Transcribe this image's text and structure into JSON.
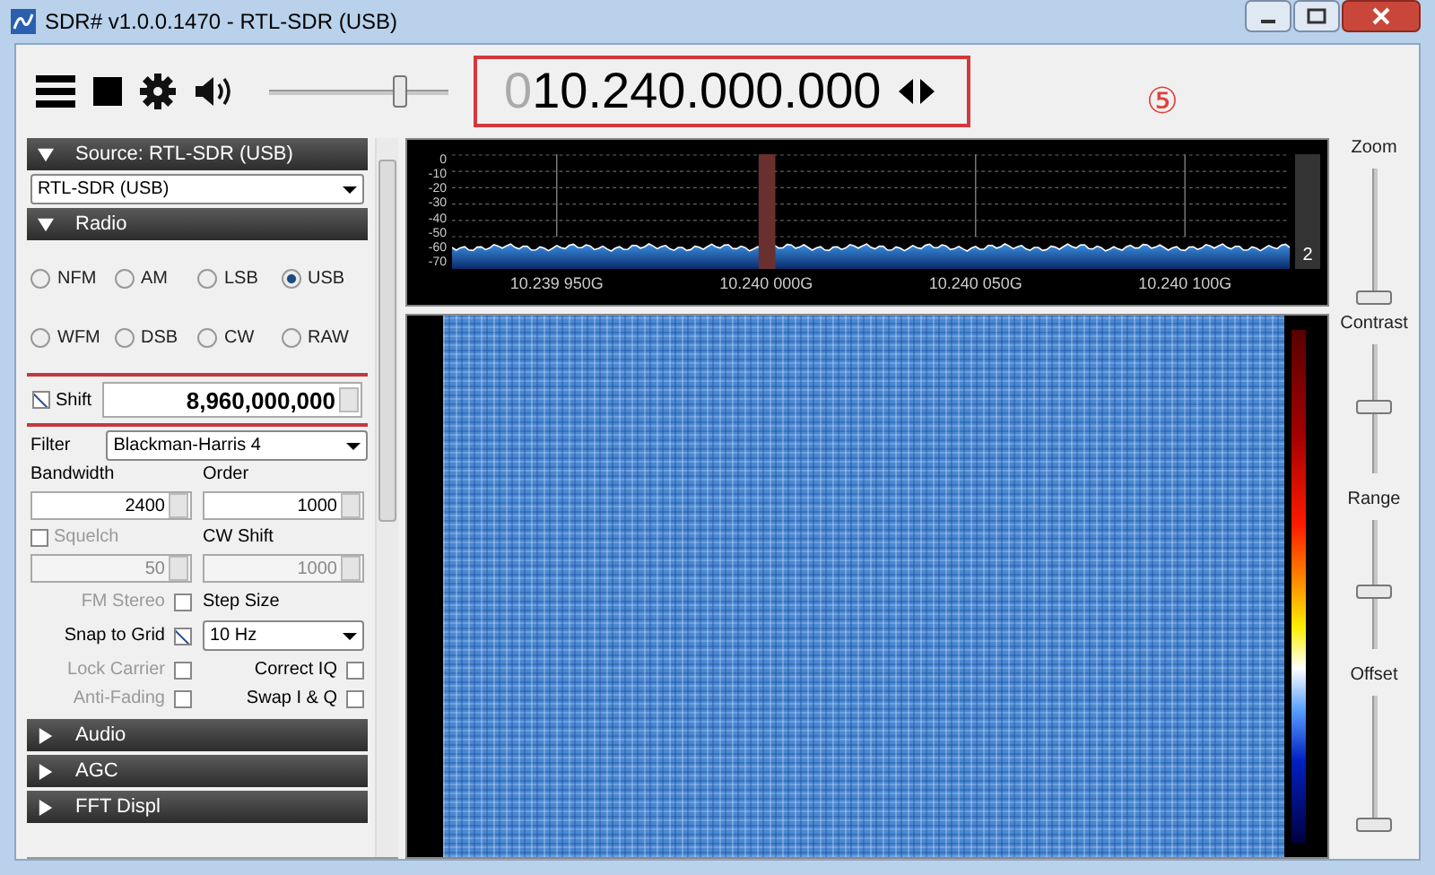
{
  "window": {
    "title": "SDR# v1.0.0.1470 - RTL-SDR (USB)"
  },
  "volume": {
    "level": 0.73
  },
  "frequency": {
    "dimmed_digits": "0",
    "digits": "10.240.000.000",
    "highlighted": true
  },
  "annotation": "⑤",
  "source": {
    "header": "Source: RTL-SDR (USB)",
    "expanded": true,
    "device": "RTL-SDR (USB)"
  },
  "radio": {
    "header": "Radio",
    "expanded": true,
    "modes": [
      {
        "label": "NFM",
        "selected": false
      },
      {
        "label": "AM",
        "selected": false
      },
      {
        "label": "LSB",
        "selected": false
      },
      {
        "label": "USB",
        "selected": true
      },
      {
        "label": "WFM",
        "selected": false
      },
      {
        "label": "DSB",
        "selected": false
      },
      {
        "label": "CW",
        "selected": false
      },
      {
        "label": "RAW",
        "selected": false
      }
    ],
    "shift": {
      "label": "Shift",
      "checked": true,
      "value": "8,960,000,000",
      "highlighted": true
    },
    "filter": {
      "label": "Filter",
      "value": "Blackman-Harris 4"
    },
    "bandwidth": {
      "label": "Bandwidth",
      "value": "2400"
    },
    "order": {
      "label": "Order",
      "value": "1000"
    },
    "squelch": {
      "label": "Squelch",
      "checked": false,
      "disabled": true,
      "value": "50"
    },
    "cw_shift": {
      "label": "CW Shift",
      "value": "1000",
      "disabled": true
    },
    "step_size": {
      "label": "Step Size",
      "value": "10 Hz"
    },
    "left_options": [
      {
        "label": "FM Stereo",
        "checked": false,
        "disabled": true
      },
      {
        "label": "Snap to Grid",
        "checked": true,
        "disabled": false
      },
      {
        "label": "Lock Carrier",
        "checked": false,
        "disabled": true
      },
      {
        "label": "Anti-Fading",
        "checked": false,
        "disabled": true
      }
    ],
    "right_options": [
      {
        "label": "Correct IQ",
        "checked": false,
        "disabled": false
      },
      {
        "label": "Swap I & Q",
        "checked": false,
        "disabled": false
      }
    ]
  },
  "collapsed_sections": [
    {
      "header": "Audio",
      "expanded": false
    },
    {
      "header": "AGC",
      "expanded": false
    },
    {
      "header": "FFT Displ",
      "expanded": false
    }
  ],
  "spectrum": {
    "y_ticks": [
      "0",
      "-10",
      "-20",
      "-30",
      "-40",
      "-50",
      "-60",
      "-70"
    ],
    "x_labels": [
      "10.239 950G",
      "10.240 000G",
      "10.240 050G",
      "10.240 100G"
    ],
    "gain_label": "2"
  },
  "sliders": [
    {
      "label": "Zoom",
      "level": 0
    },
    {
      "label": "Contrast",
      "level": 0.52
    },
    {
      "label": "Range",
      "level": 0.44
    },
    {
      "label": "Offset",
      "level": 0
    }
  ]
}
